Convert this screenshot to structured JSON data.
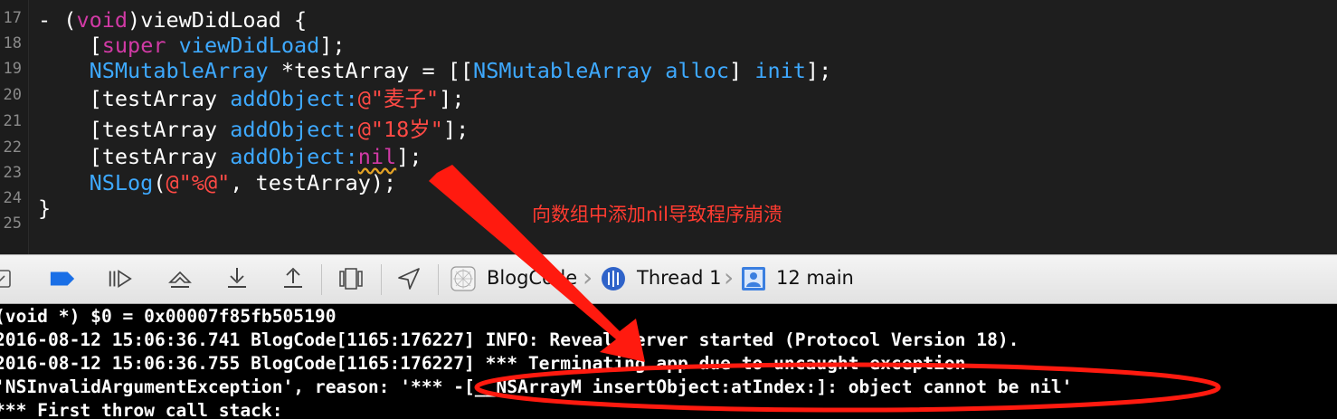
{
  "editor": {
    "line_numbers": [
      "17",
      "18",
      "19",
      "20",
      "21",
      "22",
      "23",
      "24",
      "25"
    ],
    "lines": [
      [
        {
          "t": "- (",
          "c": ""
        },
        {
          "t": "void",
          "c": "kw"
        },
        {
          "t": ")viewDidLoad {",
          "c": ""
        }
      ],
      [
        {
          "t": "    [",
          "c": ""
        },
        {
          "t": "super",
          "c": "kw"
        },
        {
          "t": " ",
          "c": ""
        },
        {
          "t": "viewDidLoad",
          "c": "fn"
        },
        {
          "t": "];",
          "c": ""
        }
      ],
      [
        {
          "t": "    ",
          "c": ""
        },
        {
          "t": "NSMutableArray",
          "c": "fn"
        },
        {
          "t": " *testArray = [[",
          "c": ""
        },
        {
          "t": "NSMutableArray",
          "c": "fn"
        },
        {
          "t": " ",
          "c": ""
        },
        {
          "t": "alloc",
          "c": "fn"
        },
        {
          "t": "] ",
          "c": ""
        },
        {
          "t": "init",
          "c": "fn"
        },
        {
          "t": "];",
          "c": ""
        }
      ],
      [
        {
          "t": "    [testArray ",
          "c": ""
        },
        {
          "t": "addObject:",
          "c": "fn"
        },
        {
          "t": "@\"麦子\"",
          "c": "str"
        },
        {
          "t": "];",
          "c": ""
        }
      ],
      [
        {
          "t": "    [testArray ",
          "c": ""
        },
        {
          "t": "addObject:",
          "c": "fn"
        },
        {
          "t": "@\"18岁\"",
          "c": "str"
        },
        {
          "t": "];",
          "c": ""
        }
      ],
      [
        {
          "t": "    [testArray ",
          "c": ""
        },
        {
          "t": "addObject:",
          "c": "fn"
        },
        {
          "t": "nil",
          "c": "kw sq"
        },
        {
          "t": "];",
          "c": ""
        }
      ],
      [
        {
          "t": "    ",
          "c": ""
        },
        {
          "t": "NSLog",
          "c": "fn"
        },
        {
          "t": "(",
          "c": ""
        },
        {
          "t": "@\"%@\"",
          "c": "str"
        },
        {
          "t": ", testArray);",
          "c": ""
        }
      ],
      [
        {
          "t": "}",
          "c": ""
        }
      ],
      []
    ],
    "annotation": "向数组中添加nil导致程序崩溃"
  },
  "debug_bar": {
    "breadcrumbs": [
      "BlogCode",
      "Thread 1",
      "12 main"
    ]
  },
  "console": {
    "lines": [
      "(void *) $0 = 0x00007f85fb505190",
      "2016-08-12 15:06:36.741 BlogCode[1165:176227] INFO: Reveal Server started (Protocol Version 18).",
      "2016-08-12 15:06:36.755 BlogCode[1165:176227] *** Terminating app due to uncaught exception",
      "'NSInvalidArgumentException', reason: '*** -[__NSArrayM insertObject:atIndex:]: object cannot be nil'",
      "*** First throw call stack:"
    ]
  },
  "colors": {
    "editor_bg": "#1e1e1e",
    "keyword": "#d13aa5",
    "method": "#3ea9ff",
    "string": "#ff4a45",
    "annotation": "#ff3b30",
    "debug_blue": "#1a6fe6"
  },
  "icons": [
    "breakpoint-toggle-icon",
    "continue-icon",
    "step-over-icon",
    "step-into-icon",
    "step-out-icon",
    "view-hierarchy-icon",
    "location-icon",
    "app-icon",
    "thread-icon",
    "frame-icon",
    "arrow-annotation",
    "ellipse-annotation"
  ]
}
